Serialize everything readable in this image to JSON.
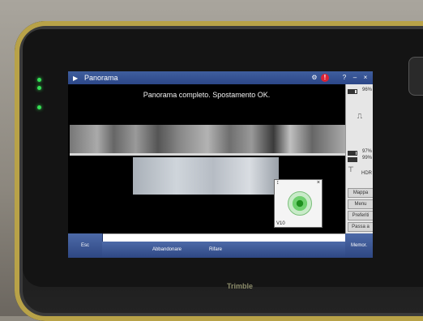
{
  "window": {
    "title": "Panorama",
    "help_icon": "?",
    "minimize_icon": "–",
    "close_icon": "×"
  },
  "message": "Panorama completo. Spostamento OK.",
  "sidebar": {
    "top_battery_pct": "96%",
    "battery1_pct": "97%",
    "battery2_pct": "99%",
    "hdr_label": "HDR",
    "buttons": [
      "Mappa",
      "Menu",
      "Preferiti",
      "Passa a"
    ],
    "memor_label": "Memor."
  },
  "level_widget": {
    "label": "V10"
  },
  "bottom": {
    "esc_label": "Esc",
    "abbandonare_label": "Abbandonare",
    "rifare_label": "Rifare"
  },
  "brand": "Trimble",
  "colors": {
    "titlebar": "#3f5e9e",
    "button": "#2e4783",
    "led": "#35e055"
  }
}
